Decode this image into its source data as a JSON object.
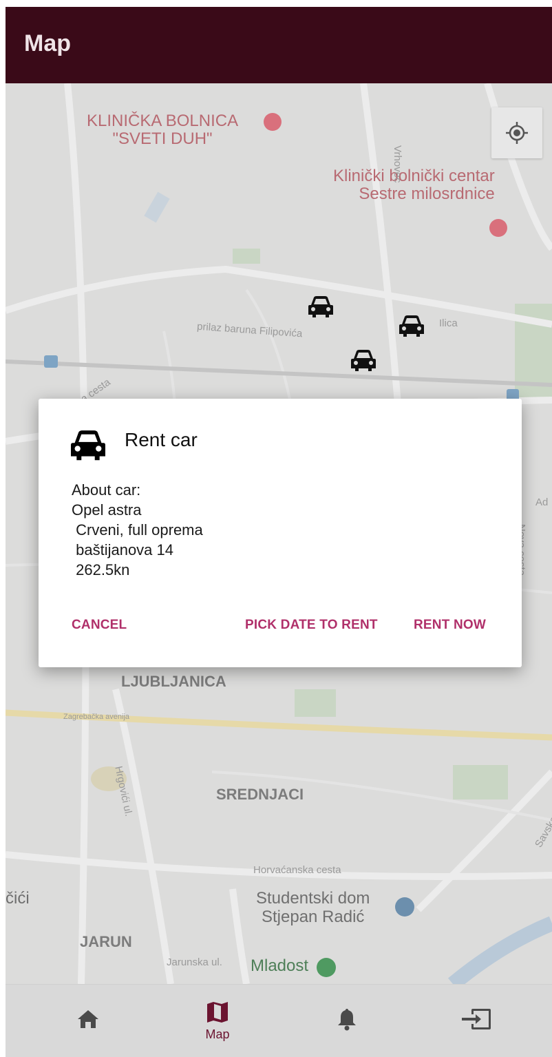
{
  "appbar": {
    "title": "Map"
  },
  "map": {
    "pois": [
      {
        "name_line1": "KLINIČKA BOLNICA",
        "name_line2": "\"SVETI DUH\""
      },
      {
        "name_line1": "Klinički bolnički centar",
        "name_line2": "Sestre milosrdnice"
      }
    ],
    "streets": {
      "vrhovec": "Vrhovec",
      "prilaz": "prilaz baruna Filipovića",
      "ilica": "Ilica",
      "ka_cesta": "ka cesta",
      "zagrebacka": "Zagrebačka avenija",
      "hrgovici": "Hrgovići ul.",
      "horvacanska": "Horvaćanska cesta",
      "jarunska": "Jarunska ul.",
      "nova_cesta": "Nova cesta",
      "savska": "Savska ce",
      "adz": "Ad"
    },
    "districts": {
      "ljubljanica": "LJUBLJANICA",
      "srednjaci": "SREDNJACI",
      "jarun": "JARUN",
      "cici": "čići"
    },
    "places": {
      "studentski_line1": "Studentski dom",
      "studentski_line2": "Stjepan Radić",
      "mladost": "Mladost"
    }
  },
  "dialog": {
    "title": "Rent car",
    "body": [
      "About car:",
      "Opel astra",
      " Crveni, full oprema",
      " baštijanova 14",
      " 262.5kn"
    ],
    "actions": {
      "cancel": "CANCEL",
      "pick_date": "PICK DATE TO RENT",
      "rent_now": "RENT NOW"
    }
  },
  "bottom_nav": {
    "items": [
      {
        "icon": "home-icon",
        "label": ""
      },
      {
        "icon": "map-icon",
        "label": "Map",
        "active": true
      },
      {
        "icon": "bell-icon",
        "label": ""
      },
      {
        "icon": "logout-icon",
        "label": ""
      }
    ]
  },
  "colors": {
    "appbar": "#3a0a18",
    "accent": "#b0306a",
    "active_nav": "#6b1430"
  }
}
